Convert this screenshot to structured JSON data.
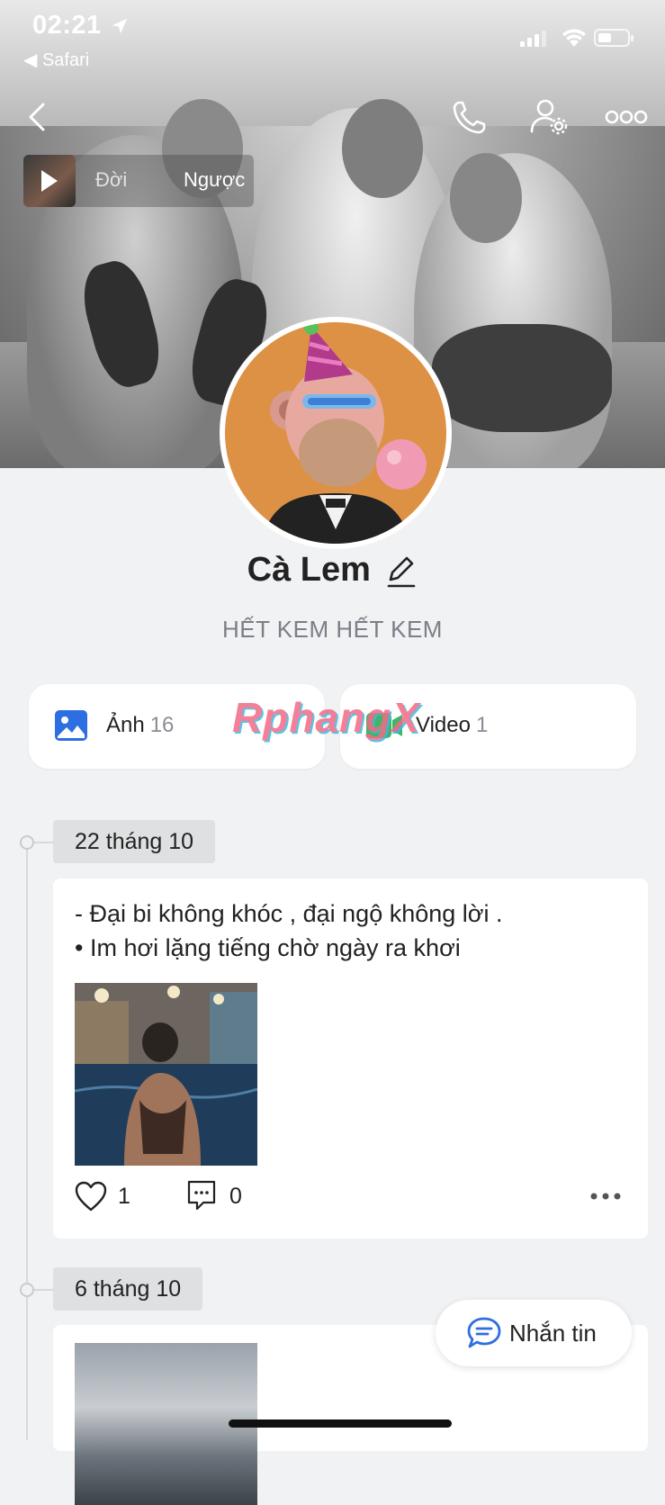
{
  "status_bar": {
    "time": "02:21",
    "back_app": "◀ Safari",
    "battery_percent": 40
  },
  "music": {
    "title_left": "Đời",
    "title_right": "Ngược"
  },
  "profile": {
    "name": "Cà Lem",
    "bio": "HẾT KEM HẾT KEM"
  },
  "media": {
    "photos_label": "Ảnh",
    "photos_count": "16",
    "videos_label": "Video",
    "videos_count": "1"
  },
  "watermark": "RphangX",
  "timeline": [
    {
      "date": "22 tháng 10",
      "text_line1": "- Đại bi không khóc , đại ngộ không lời .",
      "text_line2": "• Im hơi lặng tiếng chờ ngày ra khơi",
      "likes": "1",
      "comments": "0"
    },
    {
      "date": "6 tháng 10"
    }
  ],
  "message_button": {
    "label": "Nhắn tin"
  },
  "colors": {
    "accent_blue": "#2d6fe0",
    "avatar_bg": "#dd9144",
    "page_bg": "#f1f2f4"
  }
}
